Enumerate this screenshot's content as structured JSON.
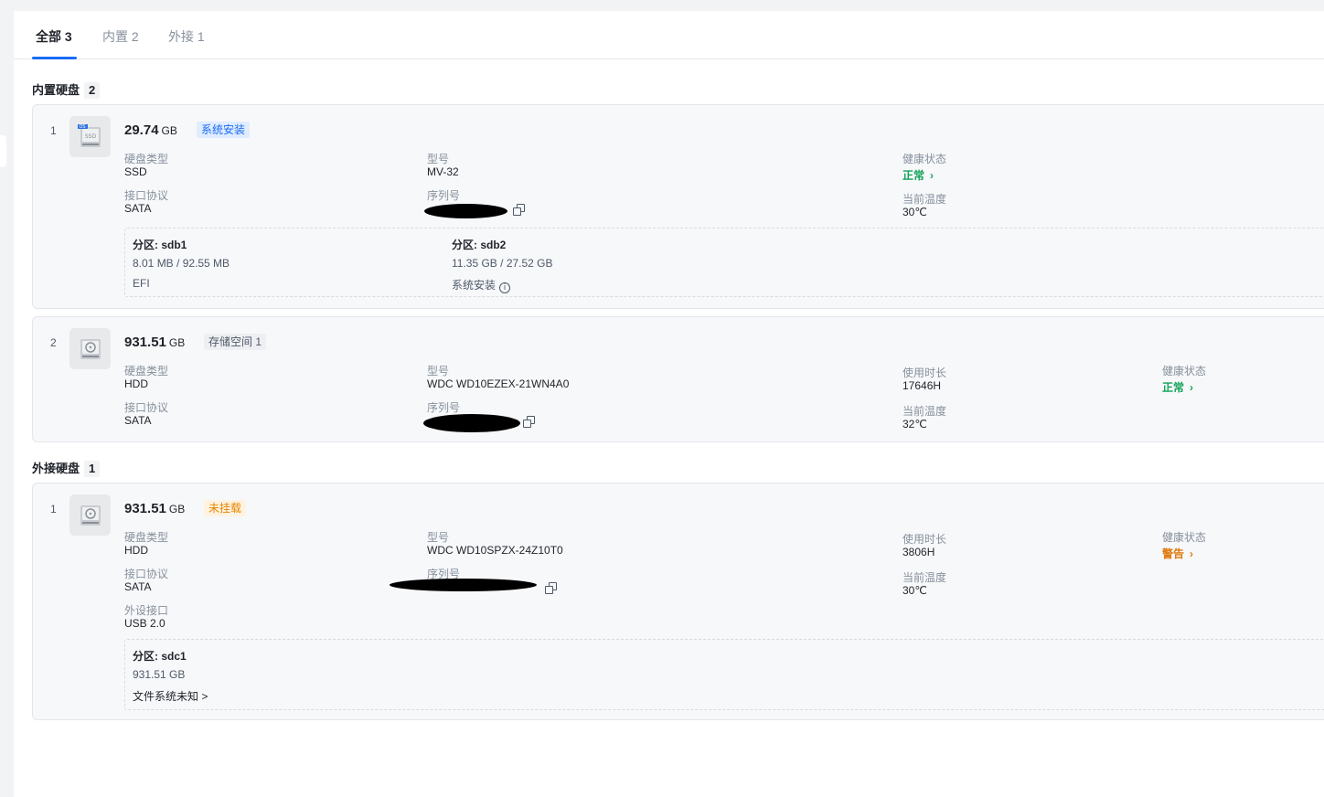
{
  "tabs": [
    {
      "label": "全部 3"
    },
    {
      "label": "内置 2"
    },
    {
      "label": "外接 1"
    }
  ],
  "sections": {
    "internal": {
      "title": "内置硬盘",
      "count": "2"
    },
    "external": {
      "title": "外接硬盘",
      "count": "1"
    }
  },
  "labels": {
    "disk_type": "硬盘类型",
    "interface": "接口协议",
    "model": "型号",
    "serial": "序列号",
    "health": "健康状态",
    "temp": "当前温度",
    "usage_time": "使用时长",
    "ext_port": "外设接口"
  },
  "disks": [
    {
      "index": "1",
      "icon": "ssd-os-icon",
      "size": "29.74",
      "unit": "GB",
      "tag": "系统安装",
      "disk_type": "SSD",
      "interface": "SATA",
      "model": "MV-32",
      "health": "正常",
      "temp": "30℃",
      "partitions": [
        {
          "title": "分区:  sdb1",
          "usage": "8.01 MB / 92.55 MB",
          "desc": "EFI"
        },
        {
          "title": "分区:  sdb2",
          "usage": "11.35 GB / 27.52 GB",
          "desc": "系统安装"
        }
      ]
    },
    {
      "index": "2",
      "icon": "hdd-icon",
      "size": "931.51",
      "unit": "GB",
      "tag": "存储空间 1",
      "disk_type": "HDD",
      "interface": "SATA",
      "model": "WDC WD10EZEX-21WN4A0",
      "usage_time": "17646H",
      "temp": "32℃",
      "health": "正常"
    },
    {
      "index": "1",
      "icon": "hdd-icon",
      "size": "931.51",
      "unit": "GB",
      "tag": "未挂载",
      "disk_type": "HDD",
      "interface": "SATA",
      "ext_port": "USB 2.0",
      "model": "WDC WD10SPZX-24Z10T0",
      "usage_time": "3806H",
      "temp": "30℃",
      "health": "警告",
      "partitions": [
        {
          "title": "分区:  sdc1",
          "usage": "931.51 GB",
          "desc": "文件系统未知 >"
        }
      ]
    }
  ],
  "colors": {
    "accent": "#1a6cf5",
    "ok": "#14a35a",
    "warn": "#e0780c",
    "tag_orange": "#e28700"
  }
}
